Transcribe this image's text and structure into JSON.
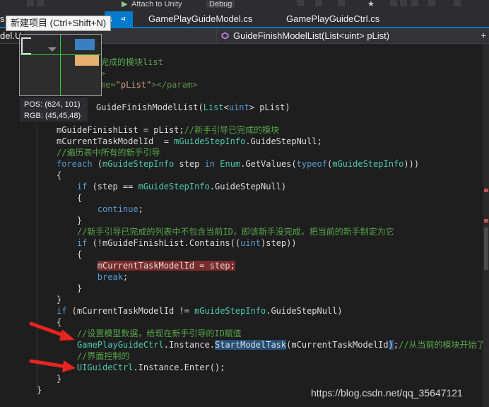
{
  "window": {
    "toolbar": {
      "attach_label": "Attach to Unity",
      "config_label": "Debug"
    },
    "tooltip": "新建项目 (Ctrl+Shift+N)",
    "tabs": [
      {
        "label": "s",
        "active": false
      },
      {
        "label": "s",
        "active": true
      },
      {
        "label": "GamePlayGuideModel.cs",
        "active": false
      },
      {
        "label": "GamePlayGuideCtrl.cs",
        "active": false
      }
    ],
    "tab_pin_glyph": "⊲",
    "nav_left": "del.U",
    "nav_right": "GuideFinishModelList(List<uint> pList)"
  },
  "picker": {
    "pos_label": "POS:",
    "pos_value": "(624, 101)",
    "rgb_label": "RGB:",
    "rgb_value": "(45,45,48)"
  },
  "code": {
    "lines": [
      {
        "text": "完成的模块list",
        "parts": [
          {
            "t": "完成的模块list",
            "c": "c-comment"
          }
        ]
      },
      {
        "text": ">",
        "parts": [
          {
            "t": ">",
            "c": "c-xml"
          }
        ]
      },
      {
        "text": "me=\"pList\"></param>",
        "parts": [
          {
            "t": "me=",
            "c": "c-xml"
          },
          {
            "t": "\"pList\"",
            "c": "c-xmlstr"
          },
          {
            "t": "></param>",
            "c": "c-xml"
          }
        ]
      },
      {
        "text": "",
        "parts": []
      },
      {
        "text": "GuideFinishModelList(List<uint> pList)",
        "parts": [
          {
            "t": "GuideFinishModelList(",
            "c": "c-plain"
          },
          {
            "t": "List",
            "c": "c-type"
          },
          {
            "t": "<",
            "c": "c-plain"
          },
          {
            "t": "uint",
            "c": "c-key"
          },
          {
            "t": "> pList)",
            "c": "c-plain"
          }
        ]
      },
      {
        "text": "",
        "parts": []
      },
      {
        "text": "mGuideFinishList = pList;//新手引导已完成的模块",
        "parts": [
          {
            "t": "mGuideFinishList = pList;",
            "c": "c-plain"
          },
          {
            "t": "//新手引导已完成的模块",
            "c": "c-comment"
          }
        ]
      },
      {
        "text": "mCurrentTaskModelId  = mGuideStepInfo.GuideStepNull;",
        "parts": [
          {
            "t": "mCurrentTaskModelId  = ",
            "c": "c-plain"
          },
          {
            "t": "mGuideStepInfo",
            "c": "c-type"
          },
          {
            "t": ".GuideStepNull;",
            "c": "c-plain"
          }
        ]
      },
      {
        "text": "//遍历表中所有的新手引导",
        "parts": [
          {
            "t": "//遍历表中所有的新手引导",
            "c": "c-comment"
          }
        ]
      },
      {
        "text": "foreach (mGuideStepInfo step in Enum.GetValues(typeof(mGuideStepInfo)))",
        "parts": [
          {
            "t": "foreach",
            "c": "c-key"
          },
          {
            "t": " (",
            "c": "c-plain"
          },
          {
            "t": "mGuideStepInfo",
            "c": "c-type"
          },
          {
            "t": " step ",
            "c": "c-plain"
          },
          {
            "t": "in",
            "c": "c-key"
          },
          {
            "t": " ",
            "c": "c-plain"
          },
          {
            "t": "Enum",
            "c": "c-type"
          },
          {
            "t": ".GetValues(",
            "c": "c-plain"
          },
          {
            "t": "typeof",
            "c": "c-key"
          },
          {
            "t": "(",
            "c": "c-plain"
          },
          {
            "t": "mGuideStepInfo",
            "c": "c-type"
          },
          {
            "t": ")))",
            "c": "c-plain"
          }
        ]
      },
      {
        "text": "{",
        "parts": [
          {
            "t": "{",
            "c": "c-plain"
          }
        ]
      },
      {
        "text": "    if (step == mGuideStepInfo.GuideStepNull)",
        "parts": [
          {
            "t": "    ",
            "c": "c-plain"
          },
          {
            "t": "if",
            "c": "c-key"
          },
          {
            "t": " (step == ",
            "c": "c-plain"
          },
          {
            "t": "mGuideStepInfo",
            "c": "c-type"
          },
          {
            "t": ".GuideStepNull)",
            "c": "c-plain"
          }
        ]
      },
      {
        "text": "    {",
        "parts": [
          {
            "t": "    {",
            "c": "c-plain"
          }
        ]
      },
      {
        "text": "        continue;",
        "parts": [
          {
            "t": "        ",
            "c": "c-plain"
          },
          {
            "t": "continue",
            "c": "c-key"
          },
          {
            "t": ";",
            "c": "c-plain"
          }
        ]
      },
      {
        "text": "    }",
        "parts": [
          {
            "t": "    }",
            "c": "c-plain"
          }
        ]
      },
      {
        "text": "    //新手引导已完成的列表中不包含当前ID，即该新手没完成，把当前的新手制定为它",
        "parts": [
          {
            "t": "    ",
            "c": "c-plain"
          },
          {
            "t": "//新手引导已完成的列表中不包含当前ID，即该新手没完成，把当前的新手制定为它",
            "c": "c-comment"
          }
        ]
      },
      {
        "text": "    if (!mGuideFinishList.Contains((uint)step))",
        "parts": [
          {
            "t": "    ",
            "c": "c-plain"
          },
          {
            "t": "if",
            "c": "c-key"
          },
          {
            "t": " (!mGuideFinishList.Contains((",
            "c": "c-plain"
          },
          {
            "t": "uint",
            "c": "c-key"
          },
          {
            "t": ")step))",
            "c": "c-plain"
          }
        ]
      },
      {
        "text": "    {",
        "parts": [
          {
            "t": "    {",
            "c": "c-plain"
          }
        ]
      },
      {
        "text": "        mCurrentTaskModelId = step;",
        "parts": [
          {
            "t": "        ",
            "c": "c-plain"
          },
          {
            "t": "mCurrentTaskModelId = step;",
            "c": "c-plain hl-red"
          }
        ]
      },
      {
        "text": "        break;",
        "parts": [
          {
            "t": "        ",
            "c": "c-plain"
          },
          {
            "t": "break",
            "c": "c-key"
          },
          {
            "t": ";",
            "c": "c-plain"
          }
        ]
      },
      {
        "text": "    }",
        "parts": [
          {
            "t": "    }",
            "c": "c-plain"
          }
        ]
      },
      {
        "text": "}",
        "parts": [
          {
            "t": "}",
            "c": "c-plain"
          }
        ]
      },
      {
        "text": "if (mCurrentTaskModelId != mGuideStepInfo.GuideStepNull)",
        "parts": [
          {
            "t": "if",
            "c": "c-key"
          },
          {
            "t": " (mCurrentTaskModelId != ",
            "c": "c-plain"
          },
          {
            "t": "mGuideStepInfo",
            "c": "c-type"
          },
          {
            "t": ".GuideStepNull)",
            "c": "c-plain"
          }
        ]
      },
      {
        "text": "{",
        "parts": [
          {
            "t": "{",
            "c": "c-plain"
          }
        ]
      },
      {
        "text": "    //设置模型数据，给现在新手引导的ID赋值",
        "parts": [
          {
            "t": "    ",
            "c": "c-plain"
          },
          {
            "t": "//设置模型数据，给现在新手引导的ID赋值",
            "c": "c-comment"
          }
        ]
      },
      {
        "text": "    GamePlayGuideCtrl.Instance.StartModelTask(mCurrentTaskModelId);//从当前的模块开始了",
        "parts": [
          {
            "t": "    ",
            "c": "c-plain"
          },
          {
            "t": "GamePlayGuideCtrl",
            "c": "c-type"
          },
          {
            "t": ".Instance.",
            "c": "c-plain"
          },
          {
            "t": "StartModelTask",
            "c": "c-plain hl-sel"
          },
          {
            "t": "(mCurrentTaskModelId",
            "c": "c-plain"
          },
          {
            "t": ")",
            "c": "c-plain hl-sel"
          },
          {
            "t": ";",
            "c": "c-plain"
          },
          {
            "t": "//从当前的模块开始了",
            "c": "c-comment"
          }
        ]
      },
      {
        "text": "    //界面控制的",
        "parts": [
          {
            "t": "    ",
            "c": "c-plain"
          },
          {
            "t": "//界面控制的",
            "c": "c-comment"
          }
        ]
      },
      {
        "text": "    UIGuideCtrl.Instance.Enter();",
        "parts": [
          {
            "t": "    ",
            "c": "c-plain"
          },
          {
            "t": "UIGuideCtrl",
            "c": "c-type"
          },
          {
            "t": ".Instance.Enter();",
            "c": "c-plain"
          }
        ]
      },
      {
        "text": "}",
        "parts": [
          {
            "t": "}",
            "c": "c-plain"
          }
        ]
      },
      {
        "text": "}",
        "parts": [
          {
            "t": "}",
            "c": "c-plain"
          }
        ]
      }
    ]
  },
  "watermark": "https://blog.csdn.net/qq_35647121",
  "colors": {
    "accent": "#007acc",
    "editor_bg": "#1e1e1e",
    "arrow": "#e8241e"
  }
}
